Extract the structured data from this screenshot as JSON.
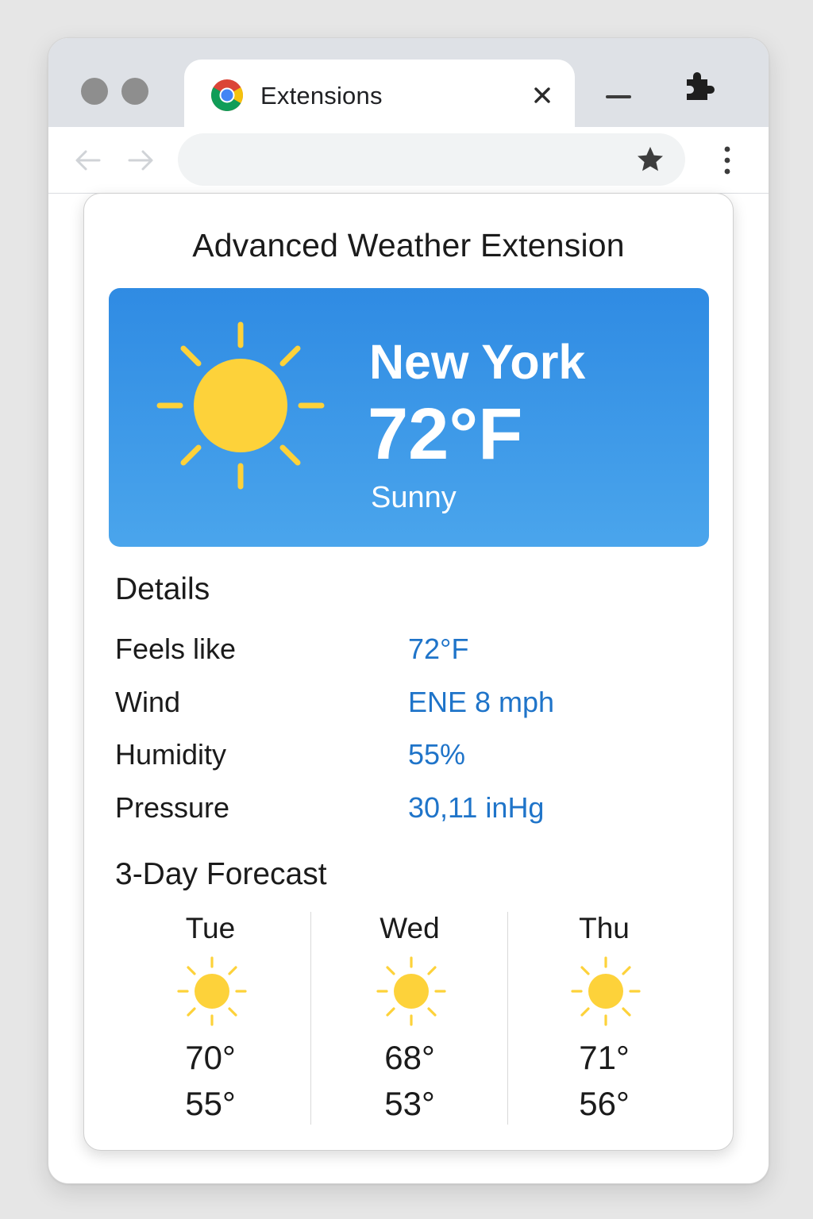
{
  "browser": {
    "tab_title": "Extensions",
    "favicon": "chrome-logo-icon",
    "tab_close_icon": "close-icon",
    "window_controls": [
      "window-control-icon",
      "window-control-icon"
    ],
    "minimize_icon": "minimize-icon",
    "extensions_icon": "puzzle-icon",
    "address_value": "",
    "bookmark_icon": "star-icon",
    "menu_icon": "kebab-menu-icon",
    "back_icon": "arrow-left-icon",
    "forward_icon": "arrow-right-icon"
  },
  "popup": {
    "title": "Advanced Weather Extension",
    "current": {
      "city": "New York",
      "temperature": "72°F",
      "condition": "Sunny",
      "icon": "sun-icon"
    },
    "details_heading": "Details",
    "details": [
      {
        "label": "Feels like",
        "value": "72°F"
      },
      {
        "label": "Wind",
        "value": "ENE 8 mph"
      },
      {
        "label": "Humidity",
        "value": "55%"
      },
      {
        "label": "Pressure",
        "value": "30,11 inHg"
      }
    ],
    "forecast_heading": "3-Day Forecast",
    "forecast": [
      {
        "day": "Tue",
        "high": "70°",
        "low": "55°",
        "icon": "sun-icon"
      },
      {
        "day": "Wed",
        "high": "68°",
        "low": "53°",
        "icon": "sun-icon"
      },
      {
        "day": "Thu",
        "high": "71°",
        "low": "56°",
        "icon": "sun-icon"
      }
    ]
  },
  "colors": {
    "hero_gradient_top": "#2f8be3",
    "hero_gradient_bottom": "#4aa5ec",
    "sun": "#fdd23a",
    "detail_value": "#1f74c9",
    "tabstrip": "#dee1e6"
  }
}
